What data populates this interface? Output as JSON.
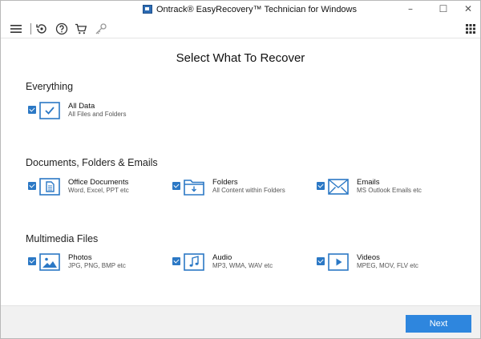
{
  "window": {
    "title": "Ontrack® EasyRecovery™ Technician for Windows",
    "controls": {
      "minimize": "–",
      "maximize": "☐",
      "close": "✕"
    }
  },
  "toolbar": {
    "icons": [
      "menu-icon",
      "recovery-history-icon",
      "help-icon",
      "cart-icon",
      "key-icon",
      "app-grid-icon"
    ]
  },
  "main": {
    "heading": "Select What To Recover",
    "sections": [
      {
        "title": "Everything",
        "options": [
          {
            "label": "All Data",
            "sub": "All Files and Folders",
            "icon": "all-data-check-icon",
            "checked": true
          }
        ]
      },
      {
        "title": "Documents, Folders & Emails",
        "options": [
          {
            "label": "Office Documents",
            "sub": "Word, Excel, PPT etc",
            "icon": "document-icon",
            "checked": true
          },
          {
            "label": "Folders",
            "sub": "All Content within Folders",
            "icon": "folder-icon",
            "checked": true
          },
          {
            "label": "Emails",
            "sub": "MS Outlook Emails etc",
            "icon": "envelope-icon",
            "checked": true
          }
        ]
      },
      {
        "title": "Multimedia Files",
        "options": [
          {
            "label": "Photos",
            "sub": "JPG, PNG, BMP etc",
            "icon": "photo-icon",
            "checked": true
          },
          {
            "label": "Audio",
            "sub": "MP3, WMA, WAV etc",
            "icon": "music-note-icon",
            "checked": true
          },
          {
            "label": "Videos",
            "sub": "MPEG, MOV, FLV etc",
            "icon": "video-play-icon",
            "checked": true
          }
        ]
      }
    ]
  },
  "footer": {
    "next_label": "Next"
  },
  "colors": {
    "accent": "#2b78c5",
    "button": "#2e86de",
    "footer_bg": "#f1f1f1"
  }
}
